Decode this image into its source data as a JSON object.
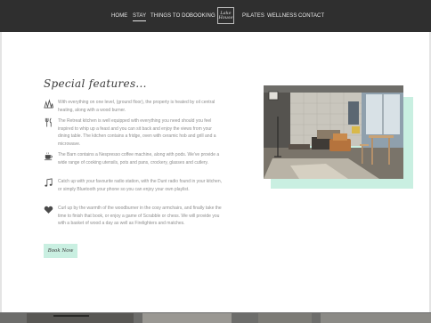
{
  "nav": {
    "items": [
      {
        "label": "HOME",
        "active": false
      },
      {
        "label": "STAY",
        "active": true
      },
      {
        "label": "THINGS TO DO",
        "active": false
      },
      {
        "label": "BOOKING",
        "active": false
      },
      {
        "label": "PILATES",
        "active": false
      },
      {
        "label": "WELLNESS",
        "active": false
      },
      {
        "label": "CONTACT",
        "active": false
      }
    ],
    "logo_text": "Lake House"
  },
  "section": {
    "title": "Special features..."
  },
  "features": [
    {
      "icon": "house-icon",
      "text": "With everything on one level, (ground floor), the property is heated by oil central heating, along with a wood burner."
    },
    {
      "icon": "cutlery-icon",
      "text": "The Retreat kitchen is well equipped with everything you need should you feel inspired to whip up a feast and you can sit back and enjoy the views from your dining table. The kitchen contains a fridge, oven with ceramic hob and grill and a microwave."
    },
    {
      "icon": "coffee-cup-icon",
      "text": "The Barn contains a Nespresso coffee machine, along with pods. We've provide a wide range of cooking utensils, pots and pans, crockery, glasses and cutlery."
    },
    {
      "icon": "music-note-icon",
      "text": "Catch up with your favourite radio station, with the Dunt radio found in your kitchen, or simply Bluetooth your phone so you can enjoy your own playlist."
    },
    {
      "icon": "heart-icon",
      "text": "Curl up by the warmth of the woodburner in the cosy armchairs, and finally take the time to finish that book, or enjoy a game of Scrabble or chess. We will provide you with a basket of wood a day as well as Firelighters and matches."
    }
  ],
  "book_button": {
    "label": "Book Now"
  },
  "colors": {
    "nav_bg": "#2f2f2f",
    "accent_mint": "#c9efe1",
    "body_text": "#8e8e8e",
    "heading_text": "#3a3a3a"
  }
}
